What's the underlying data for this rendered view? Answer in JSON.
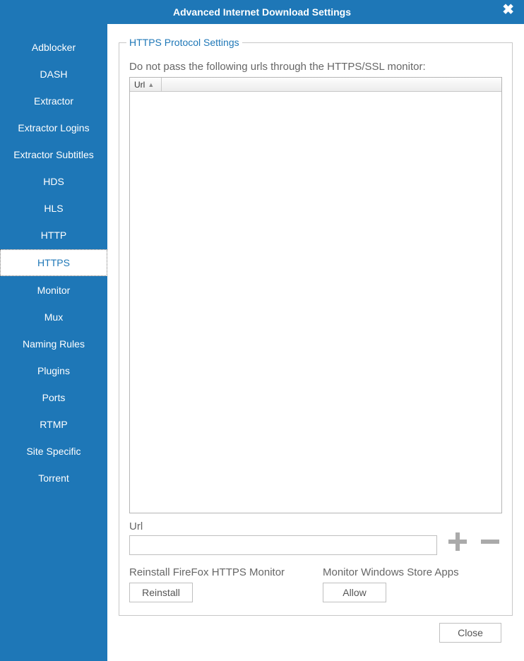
{
  "window": {
    "title": "Advanced Internet Download Settings"
  },
  "sidebar": {
    "items": [
      {
        "label": "Adblocker"
      },
      {
        "label": "DASH"
      },
      {
        "label": "Extractor"
      },
      {
        "label": "Extractor Logins"
      },
      {
        "label": "Extractor Subtitles"
      },
      {
        "label": "HDS"
      },
      {
        "label": "HLS"
      },
      {
        "label": "HTTP"
      },
      {
        "label": "HTTPS"
      },
      {
        "label": "Monitor"
      },
      {
        "label": "Mux"
      },
      {
        "label": "Naming Rules"
      },
      {
        "label": "Plugins"
      },
      {
        "label": "Ports"
      },
      {
        "label": "RTMP"
      },
      {
        "label": "Site Specific"
      },
      {
        "label": "Torrent"
      }
    ],
    "selected_index": 8
  },
  "panel": {
    "legend": "HTTPS Protocol Settings",
    "instruction": "Do not pass the following urls through the HTTPS/SSL monitor:",
    "table": {
      "columns": [
        {
          "label": "Url",
          "sorted": "asc"
        }
      ],
      "rows": []
    },
    "url_input": {
      "label": "Url",
      "value": ""
    },
    "firefox": {
      "label": "Reinstall FireFox HTTPS Monitor",
      "button": "Reinstall"
    },
    "store_apps": {
      "label": "Monitor Windows Store Apps",
      "button": "Allow"
    }
  },
  "footer": {
    "close_label": "Close"
  }
}
